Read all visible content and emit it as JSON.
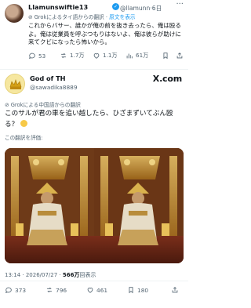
{
  "reply_tweet": {
    "author_name": "Llamunswiftie13",
    "author_handle": "@llamunn",
    "time_ago": "6日",
    "more": "···",
    "translation_source": "Grokによるタイ語からの翻訳",
    "show_original": "原文を表示",
    "text": "これからバサー、誰かが俺の前を抜き去ったら、俺は殴るよ。俺は従業員を呼ぶつもりはないよ、俺は彼らが助けに来てクビになったら怖いから。",
    "stats": {
      "replies": "53",
      "reposts": "1.7万",
      "likes": "1.1万",
      "views": "61万"
    }
  },
  "main_tweet": {
    "author_name": "God of TH",
    "author_handle": "@sawadika8889",
    "brand": "X.com",
    "translation_source": "Grokによる中国語からの翻訳",
    "text": "このサルが君の車を追い越したら、ひざまずいてぶん殴る？",
    "rate_translation": "この翻訳を評価:",
    "timestamp": "13:14 · 2026/07/27 · ",
    "view_count": "566万",
    "views_label": "回表示",
    "stats": {
      "replies": "373",
      "reposts": "796",
      "likes": "461",
      "bookmarks": "180"
    }
  },
  "colors": {
    "accent": "#1d9bf0",
    "muted": "#536471",
    "text": "#0f1419"
  }
}
